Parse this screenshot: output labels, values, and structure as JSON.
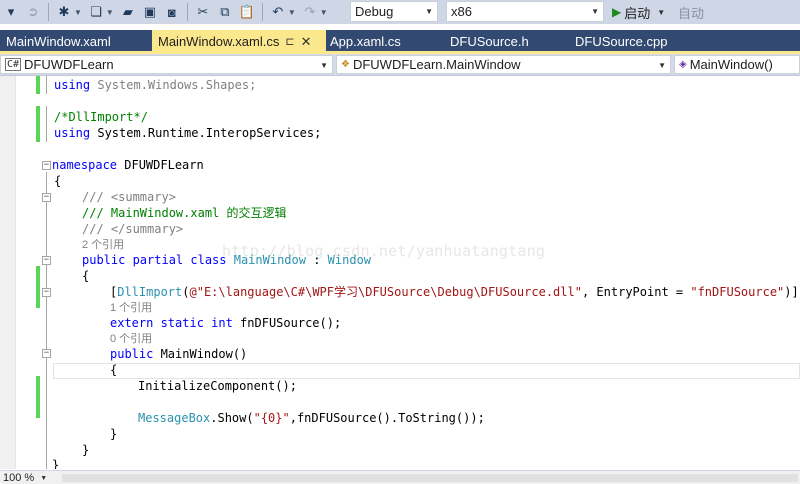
{
  "toolbar": {
    "config_value": "Debug",
    "platform_value": "x86",
    "start_label": "启动",
    "auto_label": "自动"
  },
  "tabs": [
    {
      "label": "MainWindow.xaml",
      "active": false
    },
    {
      "label": "MainWindow.xaml.cs",
      "active": true,
      "pin": "⊏",
      "close": "✕"
    },
    {
      "label": "App.xaml.cs",
      "active": false
    },
    {
      "label": "DFUSource.h",
      "active": false
    },
    {
      "label": "DFUSource.cpp",
      "active": false
    }
  ],
  "navbar": {
    "project": "DFUWDFLearn",
    "class_name": "DFUWDFLearn.MainWindow",
    "member": "MainWindow()"
  },
  "code": {
    "l1": {
      "kw": "using",
      "rest": " System.Windows.Shapes;"
    },
    "l3": "/*DllImport*/",
    "l4": {
      "kw": "using",
      "rest": " System.Runtime.InteropServices;"
    },
    "l6": {
      "kw": "namespace",
      "rest": " DFUWDFLearn"
    },
    "l7": "{",
    "l8": "/// <summary>",
    "l9": "/// MainWindow.xaml 的交互逻辑",
    "l10": "/// </summary>",
    "ref1": "2 个引用",
    "l11": {
      "kw": "public partial class",
      "type1": "MainWindow",
      "sep": " : ",
      "type2": "Window"
    },
    "l12": "{",
    "l13": {
      "open": "[",
      "attr": "DllImport",
      "paren": "(",
      "str1": "@\"E:\\language\\C#\\WPF学习\\DFUSource\\Debug\\DFUSource.dll\"",
      "mid": ", EntryPoint = ",
      "str2": "\"fnDFUSource\"",
      "close": ")]"
    },
    "ref2": "1 个引用",
    "l14": {
      "kw": "extern static int",
      "rest": " fnDFUSource();"
    },
    "ref3": "0 个引用",
    "l15": {
      "kw": "public",
      "rest": " MainWindow()"
    },
    "l16": "{",
    "l17": "InitializeComponent();",
    "l19": {
      "type": "MessageBox",
      "mid": ".Show(",
      "str": "\"{0}\"",
      "rest": ",fnDFUSource().ToString());"
    },
    "l20": "}",
    "l21": "}",
    "l22": "}"
  },
  "watermark": "http://blog.csdn.net/yanhuatangtang",
  "status": {
    "zoom": "100 %"
  }
}
